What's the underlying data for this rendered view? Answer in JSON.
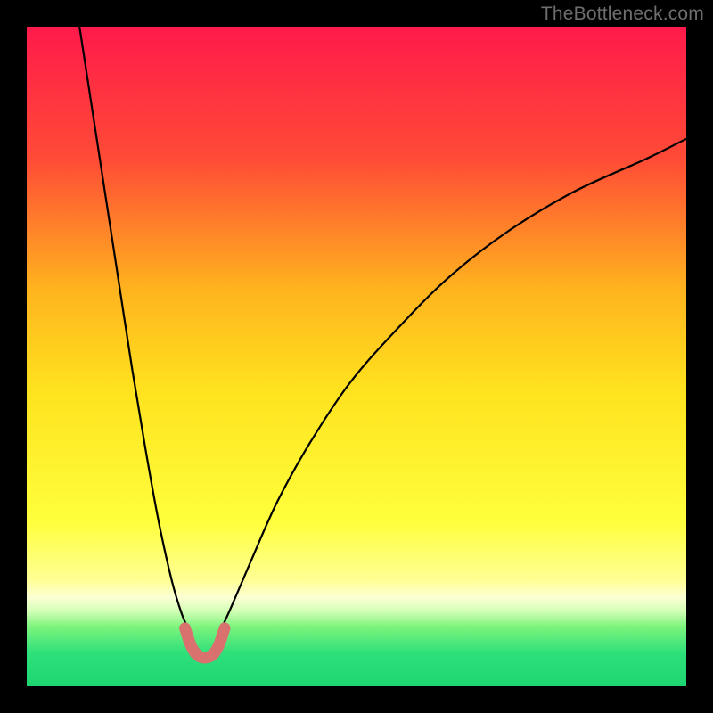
{
  "watermark": "TheBottleneck.com",
  "chart_data": {
    "type": "line",
    "title": "",
    "xlabel": "",
    "ylabel": "",
    "xlim": [
      0,
      100
    ],
    "ylim": [
      0,
      100
    ],
    "grid": false,
    "legend": false,
    "minimum_x": 27,
    "background_gradient_stops": [
      {
        "offset": 0,
        "color": "#ff1a4b"
      },
      {
        "offset": 0.2,
        "color": "#ff4b36"
      },
      {
        "offset": 0.4,
        "color": "#ffb41e"
      },
      {
        "offset": 0.55,
        "color": "#ffe21e"
      },
      {
        "offset": 0.75,
        "color": "#ffff3c"
      },
      {
        "offset": 0.84,
        "color": "#ffff96"
      },
      {
        "offset": 0.865,
        "color": "#fbffd4"
      },
      {
        "offset": 0.885,
        "color": "#d6ffb8"
      },
      {
        "offset": 0.91,
        "color": "#7cf47c"
      },
      {
        "offset": 0.95,
        "color": "#2de07a"
      },
      {
        "offset": 1.0,
        "color": "#1ed670"
      }
    ],
    "series": [
      {
        "name": "curve-left",
        "stroke": "#000000",
        "stroke_width": 2.2,
        "x": [
          8,
          10,
          12,
          14,
          16,
          18,
          20,
          22,
          23.5,
          24.6
        ],
        "y": [
          100,
          87,
          74,
          61,
          48,
          36,
          25,
          16,
          11,
          8.5
        ]
      },
      {
        "name": "curve-right",
        "stroke": "#000000",
        "stroke_width": 2.2,
        "x": [
          29.4,
          31,
          34,
          38,
          43,
          49,
          56,
          64,
          73,
          83,
          94,
          100
        ],
        "y": [
          8.5,
          12,
          19,
          28,
          37,
          46,
          54,
          62,
          69,
          75,
          80,
          83
        ]
      },
      {
        "name": "trough-highlight",
        "stroke": "#d9716e",
        "stroke_width": 13,
        "linecap": "round",
        "x": [
          24.0,
          24.8,
          25.6,
          26.5,
          27.5,
          28.4,
          29.2,
          30.0
        ],
        "y": [
          8.8,
          6.4,
          5.0,
          4.4,
          4.4,
          5.0,
          6.4,
          8.8
        ]
      }
    ]
  }
}
